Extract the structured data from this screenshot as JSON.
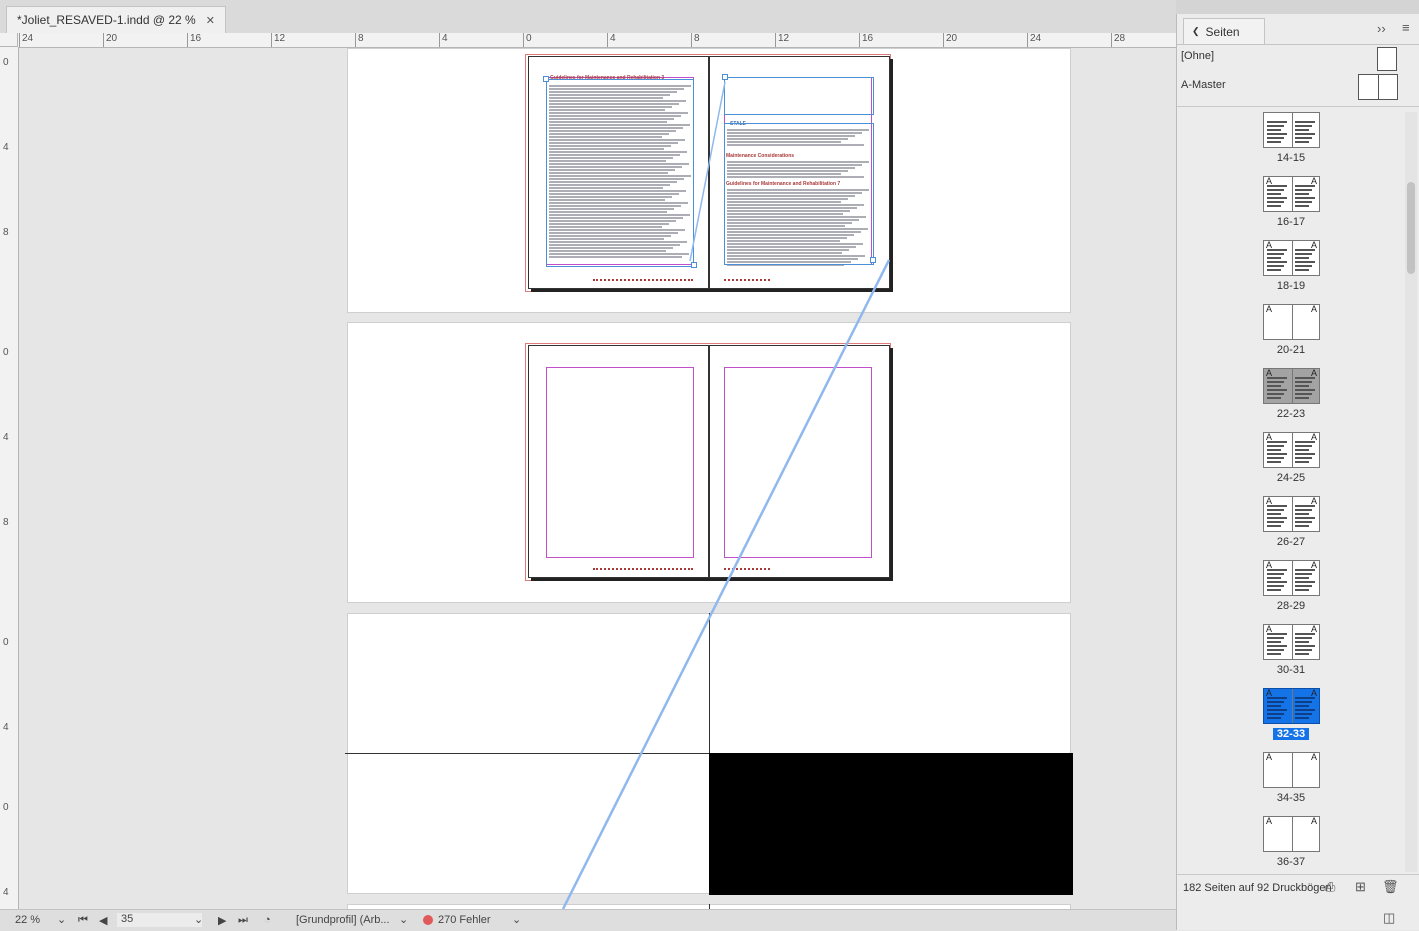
{
  "document_tab": {
    "title": "*Joliet_RESAVED-1.indd @ 22 %",
    "close_glyph": "✕"
  },
  "ruler": {
    "h_ticks": [
      "24",
      "20",
      "16",
      "12",
      "8",
      "4",
      "0",
      "4",
      "8",
      "12",
      "16",
      "20",
      "24",
      "28"
    ],
    "v_ticks": [
      "0",
      "4",
      "8",
      "0",
      "4",
      "8",
      "0",
      "4",
      "0",
      "4"
    ]
  },
  "spreads": [
    {
      "left_heading": "Guidelines for Maintenance and Rehabilitation 3",
      "right_label": "STALE",
      "right_heading_1": "Maintenance Considerations",
      "right_heading_2": "Guidelines for Maintenance and Rehabilitation 7"
    }
  ],
  "status_bar": {
    "zoom": "22 %",
    "page_number": "35",
    "profile": "[Grundprofil] (Arb...",
    "errors": "270 Fehler"
  },
  "pages_panel": {
    "tab_label": "Seiten",
    "expand_glyph": "››",
    "menu_glyph": "≡",
    "none_master": "[Ohne]",
    "a_master": "A-Master",
    "thumbnails": [
      {
        "label": "14-15"
      },
      {
        "label": "16-17"
      },
      {
        "label": "18-19"
      },
      {
        "label": "20-21"
      },
      {
        "label": "22-23"
      },
      {
        "label": "24-25"
      },
      {
        "label": "26-27"
      },
      {
        "label": "28-29"
      },
      {
        "label": "30-31"
      },
      {
        "label": "32-33"
      },
      {
        "label": "34-35"
      },
      {
        "label": "36-37"
      }
    ],
    "footer_text": "182 Seiten auf 92 Druckbögen"
  },
  "colors": {
    "selection": "#1473e6",
    "margin": "#c04fc9",
    "frame": "#4a90d9",
    "error_dot": "#e05a5a"
  }
}
